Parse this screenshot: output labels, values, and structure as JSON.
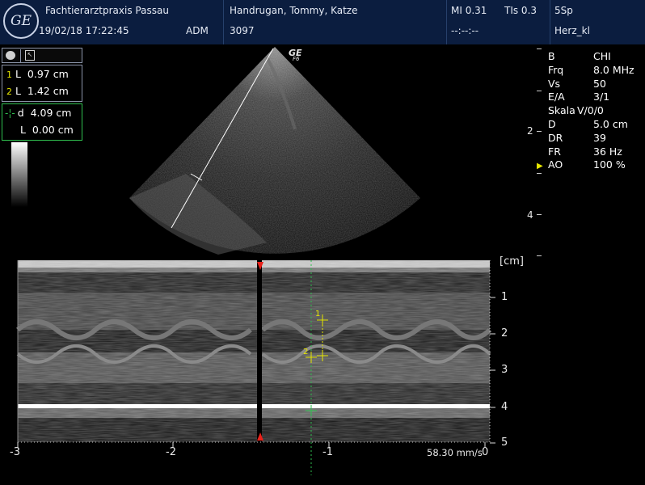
{
  "header": {
    "clinic": "Fachtierarztpraxis Passau",
    "datetime": "19/02/18 17:22:45",
    "user": "ADM",
    "patient": "Handrugan, Tommy, Katze",
    "patient_id": "3097",
    "mi": "MI 0.31",
    "tis": "TIs 0.3",
    "probe": "5Sp",
    "time_field": "--:--:--",
    "preset": "Herz_kl"
  },
  "logo_text": "GE",
  "probe_mark": {
    "brand": "GE",
    "model": "F6"
  },
  "measurements": {
    "box1": [
      {
        "index": "1",
        "label": "L",
        "value": "0.97 cm"
      },
      {
        "index": "2",
        "label": "L",
        "value": "1.42 cm"
      }
    ],
    "box2": [
      {
        "label": "d",
        "value": "4.09 cm"
      },
      {
        "label": "L",
        "value": "0.00 cm"
      }
    ]
  },
  "params": [
    {
      "key": "B",
      "value": "CHI"
    },
    {
      "key": "Frq",
      "value": "8.0 MHz"
    },
    {
      "key": "Vs",
      "value": "50"
    },
    {
      "key": "E/A",
      "value": "3/1"
    },
    {
      "key": "Skala",
      "value": "V/0/0"
    },
    {
      "key": "D",
      "value": "5.0 cm"
    },
    {
      "key": "DR",
      "value": "39"
    },
    {
      "key": "FR",
      "value": "36 Hz"
    },
    {
      "key": "AO",
      "value": "100 %"
    }
  ],
  "bmode_depth_labels": [
    "2",
    "4"
  ],
  "mmode": {
    "unit": "[cm]",
    "depth_ticks": [
      "1",
      "2",
      "3",
      "4",
      "5"
    ],
    "time_ticks": [
      "-3",
      "-2",
      "-1",
      "0"
    ],
    "sweep_speed": "58.30 mm/s"
  },
  "calipers": [
    "1",
    "2"
  ],
  "colors": {
    "header_bg": "#0b1d3f",
    "box_green": "#2fbf4f",
    "caliper_yellow": "#e6e600",
    "marker_red": "#e8211a"
  }
}
